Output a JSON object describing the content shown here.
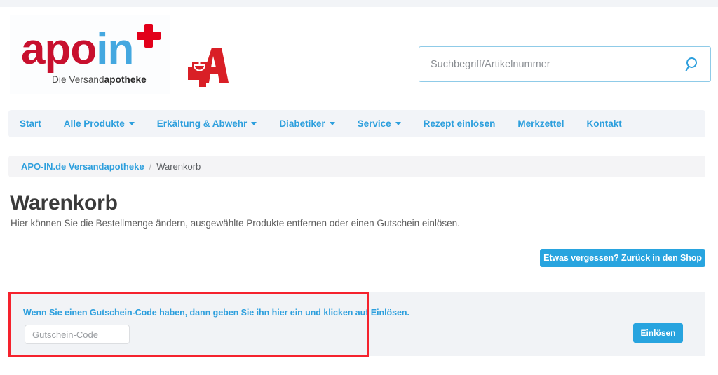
{
  "brand": {
    "logo_apo": "apo",
    "logo_in": "in",
    "tagline_prefix": "Die Versand",
    "tagline_bold": "apotheke",
    "cross_icon": "red-cross-icon",
    "pharmacy_icon": "pharmacy-a-icon",
    "accent_blue": "#2d9fdd",
    "accent_red": "#c8102e",
    "annotation_red": "#f5222d"
  },
  "search": {
    "placeholder": "Suchbegriff/Artikelnummer",
    "value": "",
    "icon": "search-icon"
  },
  "nav": {
    "items": [
      {
        "label": "Start",
        "has_caret": false
      },
      {
        "label": "Alle Produkte",
        "has_caret": true
      },
      {
        "label": "Erkältung & Abwehr",
        "has_caret": true
      },
      {
        "label": "Diabetiker",
        "has_caret": true
      },
      {
        "label": "Service",
        "has_caret": true
      },
      {
        "label": "Rezept einlösen",
        "has_caret": false
      },
      {
        "label": "Merkzettel",
        "has_caret": false
      },
      {
        "label": "Kontakt",
        "has_caret": false
      }
    ]
  },
  "breadcrumb": {
    "home": "APO-IN.de Versandapotheke",
    "separator": "/",
    "current": "Warenkorb"
  },
  "page": {
    "title": "Warenkorb",
    "description": "Hier können Sie die Bestellmenge ändern, ausgewählte Produkte entfernen oder einen Gutschein einlösen."
  },
  "actions": {
    "back_to_shop": "Etwas vergessen? Zurück in den Shop"
  },
  "voucher": {
    "hint": "Wenn Sie einen Gutschein-Code haben, dann geben Sie ihn hier ein und klicken auf Einlösen.",
    "input_placeholder": "Gutschein-Code",
    "input_value": "",
    "redeem_label": "Einlösen"
  }
}
